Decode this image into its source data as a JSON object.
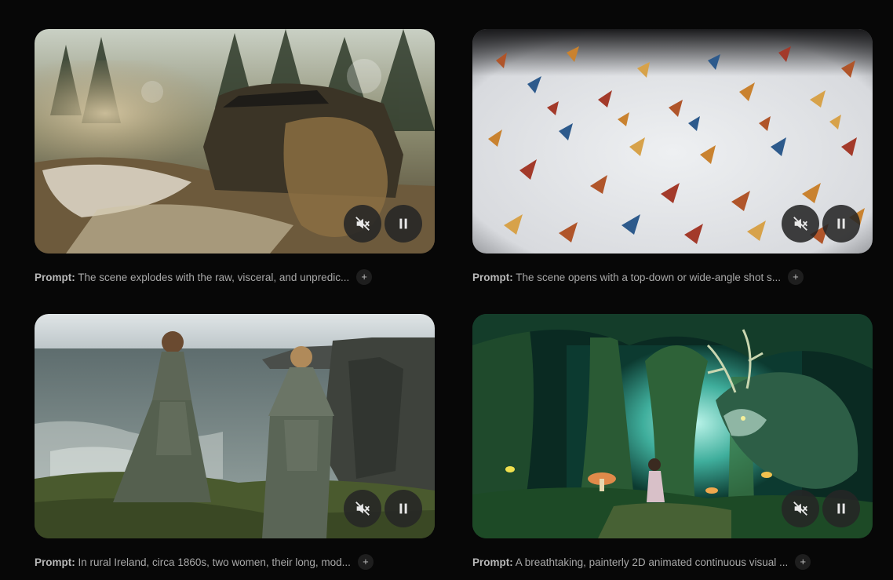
{
  "icons": {
    "mute": "volume-off-icon",
    "pause": "pause-icon",
    "expand": "plus-icon"
  },
  "colors": {
    "background": "#070707",
    "control_bg": "#262626",
    "text": "#a8a8a8"
  },
  "cards": [
    {
      "prompt_label": "Prompt:",
      "prompt_text": "The scene explodes with the raw, visceral, and unpredic...",
      "expand_label": "+"
    },
    {
      "prompt_label": "Prompt:",
      "prompt_text": "The scene opens with a top-down or wide-angle shot s...",
      "expand_label": "+"
    },
    {
      "prompt_label": "Prompt:",
      "prompt_text": "In rural Ireland, circa 1860s, two women, their long, mod...",
      "expand_label": "+"
    },
    {
      "prompt_label": "Prompt:",
      "prompt_text": "A breathtaking, painterly 2D animated continuous visual ...",
      "expand_label": "+"
    }
  ]
}
